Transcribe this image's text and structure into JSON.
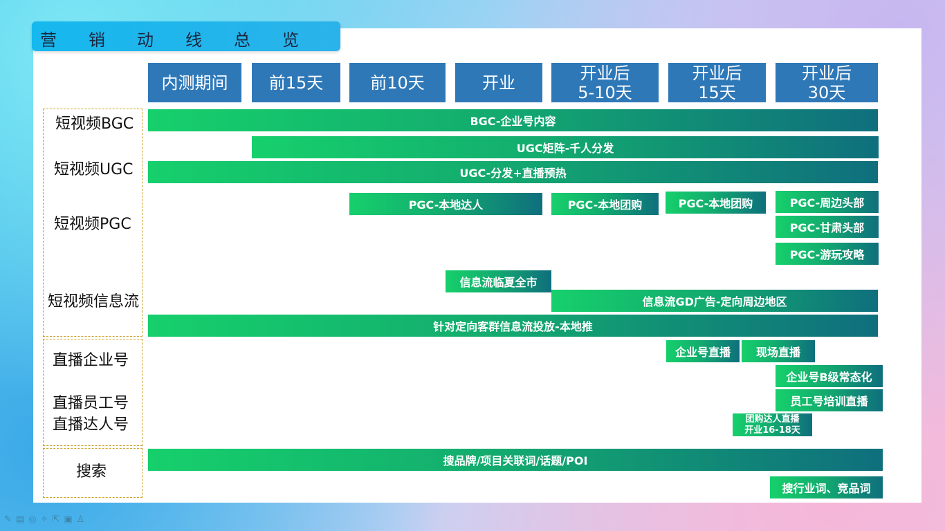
{
  "title_chars": [
    "营",
    "销",
    "动",
    "线",
    "总",
    "览"
  ],
  "columns": [
    "内测期间",
    "前15天",
    "前10天",
    "开业",
    "开业后\n5-10天",
    "开业后\n15天",
    "开业后\n30天"
  ],
  "row_labels": {
    "bgc": "短视频BGC",
    "ugc": "短视频UGC",
    "pgc": "短视频PGC",
    "feed": "短视频信息流",
    "live_company": "直播企业号",
    "live_staff": "直播员工号",
    "live_kol": "直播达人号",
    "search": "搜索"
  },
  "bars": {
    "bgc": "BGC-企业号内容",
    "ugc_matrix": "UGC矩阵-千人分发",
    "ugc_preheat": "UGC-分发+直播预热",
    "pgc_local_kol": "PGC-本地达人",
    "pgc_group_1": "PGC-本地团购",
    "pgc_group_2": "PGC-本地团购",
    "pgc_nearby": "PGC-周边头部",
    "pgc_gansu": "PGC-甘肃头部",
    "pgc_guide": "PGC-游玩攻略",
    "feed_city": "信息流临夏全市",
    "feed_gd": "信息流GD广告-定向周边地区",
    "feed_target": "针对定向客群信息流投放-本地推",
    "live_company": "企业号直播",
    "live_onsite": "现场直播",
    "live_b_level": "企业号B级常态化",
    "live_staff_training": "员工号培训直播",
    "live_group_kol_1": "团购达人直播",
    "live_group_kol_2": "开业16-18天",
    "search_brand": "搜品牌/项目关联词/话题/POI",
    "search_industry": "搜行业词、竞品词"
  },
  "colors": {
    "header": "#2f78b8",
    "bar_start": "#16d06c",
    "bar_end": "#0f6f7d",
    "title_bg": "#16b8ee",
    "dashed_border": "#c9a227"
  },
  "toolbar_icons": [
    "pen-icon",
    "highlighter-icon",
    "eraser-icon",
    "pointer-icon",
    "cursor-icon",
    "camera-icon",
    "lock-icon"
  ]
}
